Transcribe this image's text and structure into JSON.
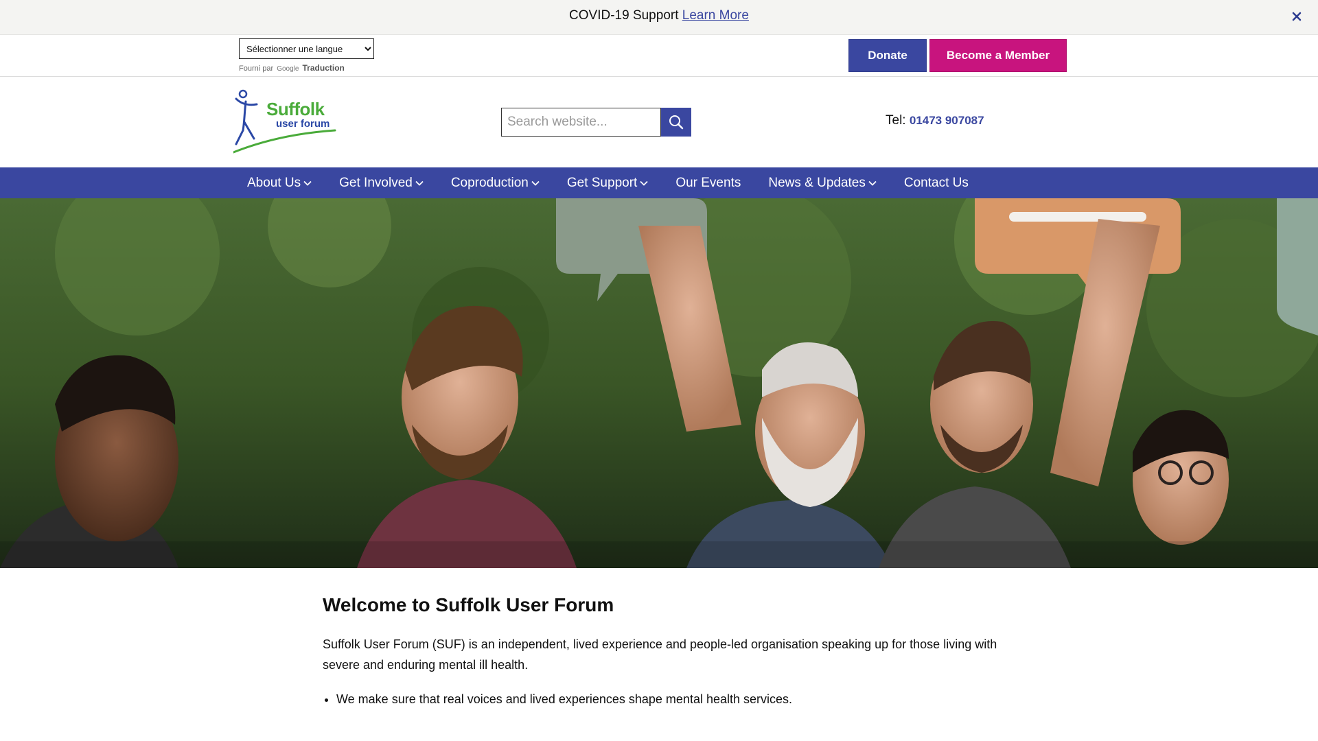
{
  "covid_banner": {
    "text": "COVID-19 Support",
    "link": "Learn More",
    "close_icon": "close-icon"
  },
  "utility": {
    "language_select": "Sélectionner une langue",
    "powered_by": "Fourni par",
    "google": "Google",
    "translate": "Traduction",
    "donate": "Donate",
    "member": "Become a Member"
  },
  "header": {
    "logo_line1": "Suffolk",
    "logo_line2": "user forum",
    "search_placeholder": "Search website...",
    "search_icon": "search-icon",
    "tel_label": "Tel:",
    "tel_number": "01473 907087"
  },
  "nav": {
    "items": [
      {
        "label": "About Us",
        "dropdown": true
      },
      {
        "label": "Get Involved",
        "dropdown": true
      },
      {
        "label": "Coproduction",
        "dropdown": true
      },
      {
        "label": "Get Support",
        "dropdown": true
      },
      {
        "label": "Our Events",
        "dropdown": false
      },
      {
        "label": "News & Updates",
        "dropdown": true
      },
      {
        "label": "Contact Us",
        "dropdown": false
      }
    ]
  },
  "content": {
    "title": "Welcome to Suffolk User Forum",
    "intro": "Suffolk User Forum (SUF) is an independent, lived experience and people-led organisation speaking up for those living with severe and enduring mental ill health.",
    "bullets": [
      "We make sure that real voices and lived experiences shape mental health services."
    ]
  },
  "colors": {
    "primary": "#3a47a0",
    "member": "#c8147e",
    "logo_green": "#4aab3a"
  }
}
